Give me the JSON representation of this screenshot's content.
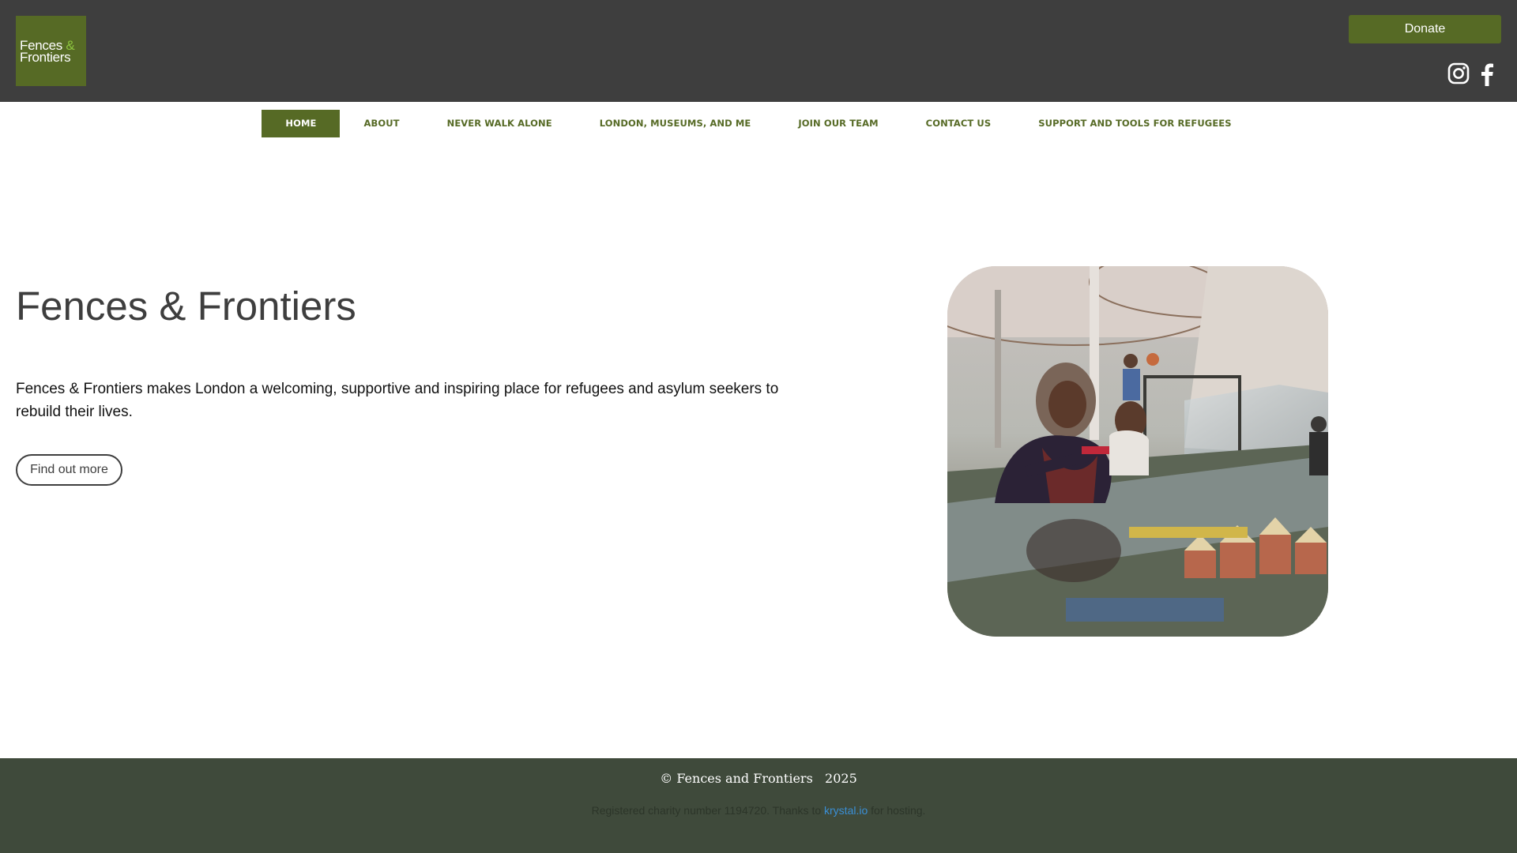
{
  "header": {
    "logo_line1": "Fences",
    "logo_amp": "&",
    "logo_line2": "Frontiers",
    "donate_label": "Donate",
    "social": [
      "instagram-icon",
      "facebook-icon"
    ]
  },
  "nav": {
    "items": [
      {
        "label": "HOME",
        "active": true
      },
      {
        "label": "ABOUT"
      },
      {
        "label": "NEVER WALK ALONE"
      },
      {
        "label": "LONDON, MUSEUMS, AND ME"
      },
      {
        "label": "JOIN OUR TEAM"
      },
      {
        "label": "CONTACT US"
      },
      {
        "label": "SUPPORT AND TOOLS FOR REFUGEES"
      }
    ]
  },
  "hero": {
    "title": "Fences & Frontiers",
    "text": "Fences & Frontiers makes London a welcoming, supportive and inspiring place for refugees and asylum seekers to rebuild their lives.",
    "button_label": "Find out more"
  },
  "footer": {
    "copyright": "© Fences and Frontiers   2025",
    "charity_before": "Registered charity number 1194720. Thanks to ",
    "charity_link": "krystal.io",
    "charity_after": " for hosting."
  },
  "colors": {
    "header_bg": "#3e3e3e",
    "brand_green": "#566a25",
    "logo_accent": "#8dc63f",
    "footer_bg": "#3f4a3b",
    "link_blue": "#3a8fd6"
  }
}
